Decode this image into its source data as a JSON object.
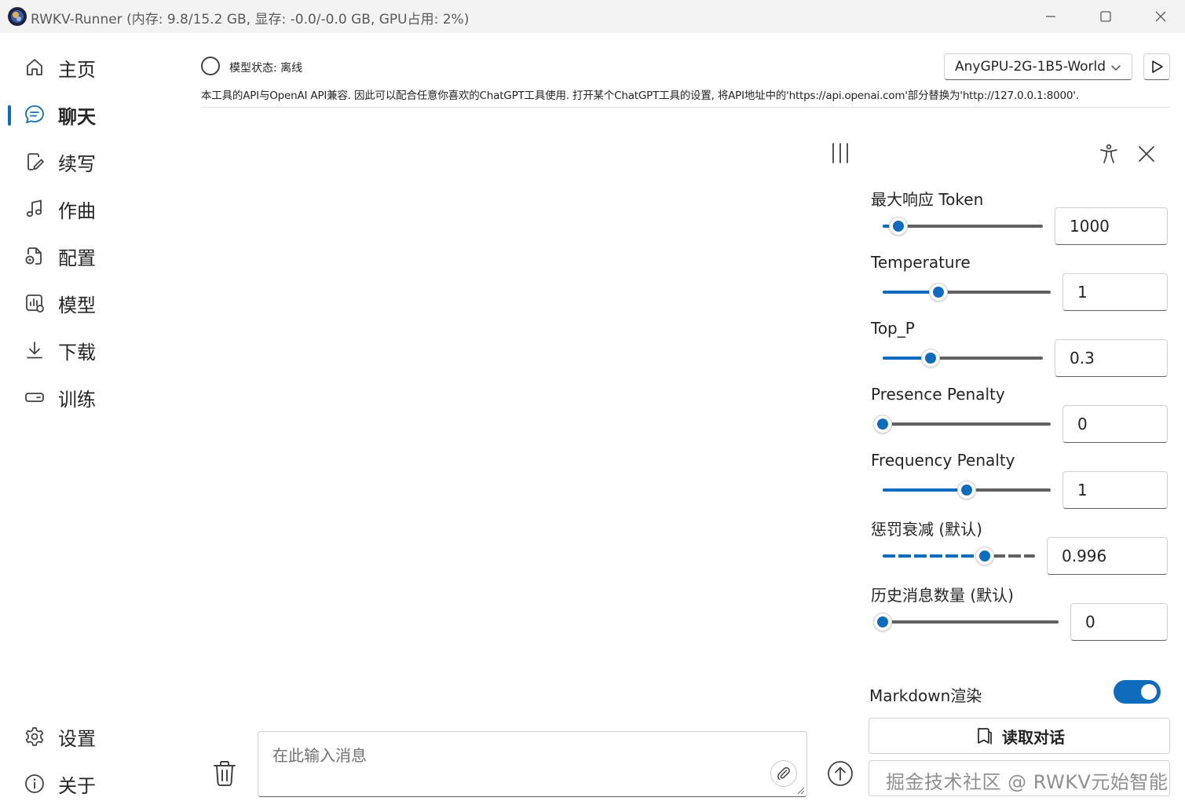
{
  "window": {
    "title": "RWKV-Runner (内存: 9.8/15.2 GB, 显存: -0.0/-0.0 GB, GPU占用: 2%)"
  },
  "sidebar": {
    "items": [
      {
        "label": "主页",
        "icon": "home-icon",
        "active": false
      },
      {
        "label": "聊天",
        "icon": "chat-icon",
        "active": true
      },
      {
        "label": "续写",
        "icon": "document-edit-icon",
        "active": false
      },
      {
        "label": "作曲",
        "icon": "music-note-icon",
        "active": false
      },
      {
        "label": "配置",
        "icon": "document-settings-icon",
        "active": false
      },
      {
        "label": "模型",
        "icon": "data-usage-icon",
        "active": false
      },
      {
        "label": "下载",
        "icon": "download-icon",
        "active": false
      },
      {
        "label": "训练",
        "icon": "drive-icon",
        "active": false
      }
    ],
    "bottom_items": [
      {
        "label": "设置",
        "icon": "gear-icon"
      },
      {
        "label": "关于",
        "icon": "info-icon"
      }
    ]
  },
  "status": {
    "text": "模型状态: 离线"
  },
  "info": {
    "text": "本工具的API与OpenAI API兼容. 因此可以配合任意你喜欢的ChatGPT工具使用. 打开某个ChatGPT工具的设置, 将API地址中的'https://api.openai.com'部分替换为'http://127.0.0.1:8000'."
  },
  "model_select": {
    "value": "AnyGPU-2G-1B5-World"
  },
  "params": [
    {
      "label": "最大响应 Token",
      "value": "1000",
      "fraction": 0.1
    },
    {
      "label": "Temperature",
      "value": "1",
      "fraction": 0.33
    },
    {
      "label": "Top_P",
      "value": "0.3",
      "fraction": 0.3
    },
    {
      "label": "Presence Penalty",
      "value": "0",
      "fraction": 0.0
    },
    {
      "label": "Frequency Penalty",
      "value": "1",
      "fraction": 0.5
    },
    {
      "label": "惩罚衰减 (默认)",
      "value": "0.996",
      "fraction": 0.67
    },
    {
      "label": "历史消息数量 (默认)",
      "value": "0",
      "fraction": 0.0
    }
  ],
  "markdown": {
    "label": "Markdown渲染",
    "on": true
  },
  "buttons": {
    "read_conversation": "读取对话"
  },
  "watermark": {
    "text": "掘金技术社区 @ RWKV元始智能"
  },
  "chat": {
    "placeholder": "在此输入消息"
  },
  "colors": {
    "accent": "#0f6cbd",
    "track": "#616161"
  }
}
